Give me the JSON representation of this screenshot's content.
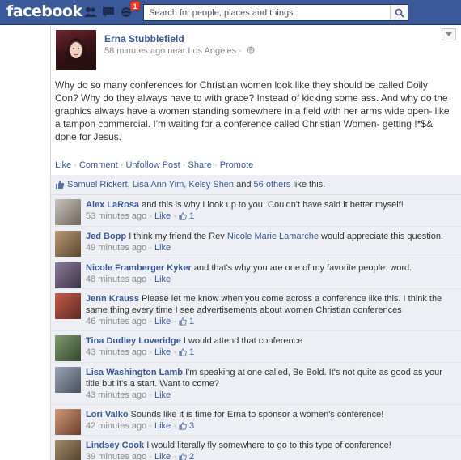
{
  "topbar": {
    "logo": "facebook",
    "notification_count": "1",
    "search_placeholder": "Search for people, places and things"
  },
  "post": {
    "author": "Erna Stubblefield",
    "meta": "58 minutes ago near Los Angeles ·",
    "text": "Why do so many conferences for Christian women look like they should be called Doily Con? Why do they always have to with grace? Instead of kicking some ass. And why do the graphics always have a women standing somewhere in a field with her arms wide open- like a tampon commercial. I'm waiting for a conference called Christian Women- getting !*$& done for Jesus.",
    "actions": {
      "like": "Like",
      "comment": "Comment",
      "unfollow": "Unfollow Post",
      "share": "Share",
      "promote": "Promote",
      "sep": "·"
    },
    "likes": {
      "names": "Samuel Rickert, Lisa Ann Yim, Kelsy Shen",
      "and": "and",
      "others": "56 others",
      "suffix": "like this."
    }
  },
  "comments": [
    {
      "name": "Alex LaRosa",
      "text": "and this is why I look up to you. Couldn't have said it better myself!",
      "time": "53 minutes ago",
      "like": "Like",
      "likes": "1"
    },
    {
      "name": "Jed Bopp",
      "text": "I think my friend the Rev",
      "mention": "Nicole Marie Lamarche",
      "text2": "would appreciate this question.",
      "time": "49 minutes ago",
      "like": "Like",
      "likes": ""
    },
    {
      "name": "Nicole Framberger Kyker",
      "text": "and that's why you are one of my favorite people. word.",
      "time": "48 minutes ago",
      "like": "Like",
      "likes": ""
    },
    {
      "name": "Jenn Krauss",
      "text": "Please let me know when you come across a conference like this. I think the same thing every time I see advertisements about women Christian conferences",
      "time": "46 minutes ago",
      "like": "Like",
      "likes": "1"
    },
    {
      "name": "Tina Dudley Loveridge",
      "text": "I would attend that conference",
      "time": "43 minutes ago",
      "like": "Like",
      "likes": "1"
    },
    {
      "name": "Lisa Washington Lamb",
      "text": "I'm speaking at one called, Be Bold. It's not quite as good as your title but it's a start. Want to come?",
      "time": "43 minutes ago",
      "like": "Like",
      "likes": ""
    },
    {
      "name": "Lori Valko",
      "text": "Sounds like it is time for Erna to sponsor a women's conference!",
      "time": "42 minutes ago",
      "like": "Like",
      "likes": "3"
    },
    {
      "name": "Lindsey Cook",
      "text": "I would literally fly somewhere to go to this type of conference!",
      "time": "39 minutes ago",
      "like": "Like",
      "likes": "2"
    }
  ],
  "colors": {
    "brand": "#3b5998",
    "feedback_bg": "#edeff4",
    "badge": "#f03d25"
  },
  "icons": [
    "friends-icon",
    "messages-icon",
    "notifications-icon",
    "search-icon",
    "globe-icon",
    "chevron-down-icon",
    "thumbs-up-icon"
  ]
}
